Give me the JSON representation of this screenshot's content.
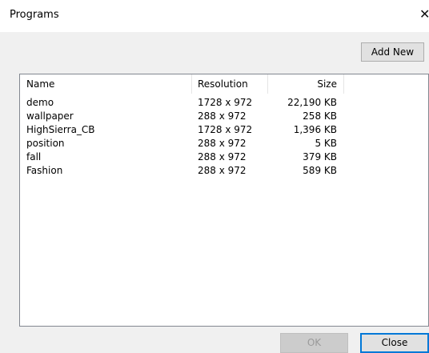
{
  "window": {
    "title": "Programs",
    "close_glyph": "✕"
  },
  "toolbar": {
    "add_new_label": "Add New"
  },
  "table": {
    "columns": [
      "Name",
      "Resolution",
      "Size"
    ],
    "rows": [
      {
        "name": "demo",
        "resolution": "1728 x 972",
        "size": "22,190 KB"
      },
      {
        "name": "wallpaper",
        "resolution": "288 x 972",
        "size": "258 KB"
      },
      {
        "name": "HighSierra_CB",
        "resolution": "1728 x 972",
        "size": "1,396 KB"
      },
      {
        "name": "position",
        "resolution": "288 x 972",
        "size": "5 KB"
      },
      {
        "name": "fall",
        "resolution": "288 x 972",
        "size": "379 KB"
      },
      {
        "name": "Fashion",
        "resolution": "288 x 972",
        "size": "589 KB"
      }
    ]
  },
  "footer": {
    "ok_label": "OK",
    "ok_enabled": false,
    "close_label": "Close"
  },
  "colors": {
    "accent": "#0078d7",
    "dialog_background": "#f0f0f0",
    "list_border": "#828790"
  }
}
